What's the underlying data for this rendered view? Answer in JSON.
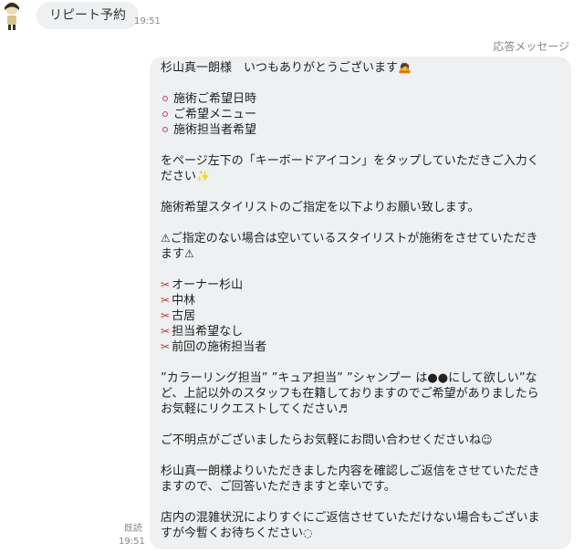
{
  "user_message": {
    "avatar": "user-avatar",
    "text": "リピート予約",
    "time": "19:51"
  },
  "bot_message": {
    "label": "応答メッセージ",
    "greeting": "杉山真一朗様　いつもありがとうございます",
    "bullets": [
      "施術ご希望日時",
      "ご希望メニュー",
      "施術担当者希望"
    ],
    "keyboard_line1": "をページ左下の「キーボードアイコン」をタップしていただきご入力く",
    "keyboard_line2": "ださい",
    "stylist_request": "施術希望スタイリストのご指定を以下よりお願い致します。",
    "warning_line1": "ご指定のない場合は空いているスタイリストが施術をさせていただき",
    "warning_line2": "ます",
    "stylists": [
      "オーナー杉山",
      "中林",
      "古居",
      "担当希望なし",
      "前回の施術担当者"
    ],
    "other_line1": "”カラーリング担当” ”キュア担当” ”シャンプー は●●にして欲しい”な",
    "other_line2": "ど、上記以外のスタッフも在籍しておりますのでご希望がありましたら",
    "other_line3": "お気軽にリクエストしてください",
    "question_line": "ご不明点がございましたらお気軽にお問い合わせくださいね",
    "confirm_line1": "杉山真一朗様よりいただきました内容を確認しご返信をさせていただき",
    "confirm_line2": "ますので、ご回答いただきますと幸いです。",
    "busy_line1": "店内の混雑状況によりすぐにご返信させていただけない場合もございま",
    "busy_line2": "すが今暫くお待ちください",
    "read_status": "既読",
    "time": "19:51"
  },
  "colors": {
    "bubble_bg": "#eef0f2",
    "bullet": "#c2407a",
    "warning": "#f1c40f",
    "scissors": "#c0392b"
  }
}
